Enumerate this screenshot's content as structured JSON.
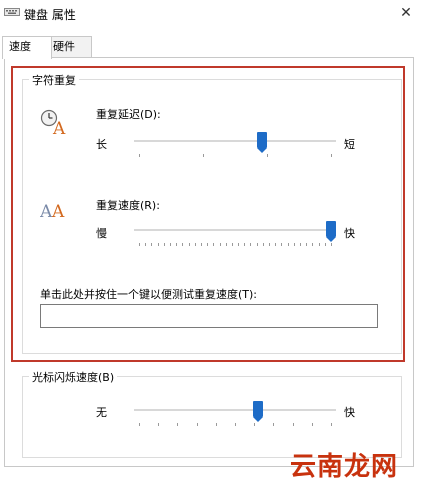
{
  "window": {
    "title": "键盘 属性",
    "close_symbol": "✕"
  },
  "tabs": [
    {
      "label": "速度",
      "active": true
    },
    {
      "label": "硬件",
      "active": false
    }
  ],
  "repeat_group": {
    "legend": "字符重复",
    "delay": {
      "label": "重复延迟(D):",
      "left_label": "长",
      "right_label": "短",
      "value_fraction": 0.64,
      "icon": "clock-a-icon"
    },
    "rate": {
      "label": "重复速度(R):",
      "left_label": "慢",
      "right_label": "快",
      "value_fraction": 1.0,
      "icon": "double-a-icon"
    },
    "test": {
      "label": "单击此处并按住一个键以便测试重复速度(T):",
      "value": ""
    }
  },
  "cursor_group": {
    "legend": "光标闪烁速度(B)",
    "left_label": "无",
    "right_label": "快",
    "value_fraction": 0.62
  },
  "highlight_color": "#c0392b",
  "accent_color": "#1e6cc7",
  "watermark": "云南龙网"
}
